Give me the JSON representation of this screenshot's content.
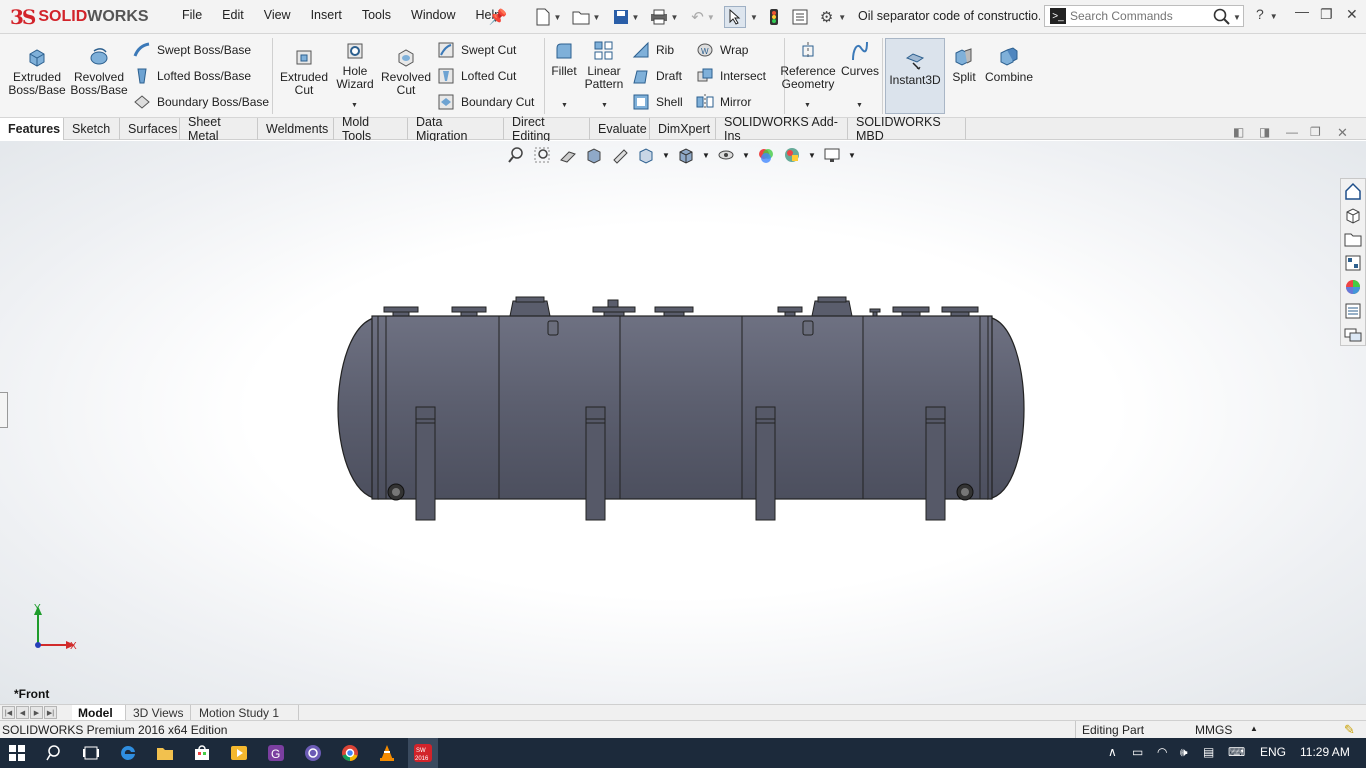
{
  "app": {
    "logo_ds": "3S",
    "logo_solid": "SOLID",
    "logo_works": "WORKS",
    "document_title": "Oil separator code of constructio...",
    "search_placeholder": "Search Commands"
  },
  "menu": [
    "File",
    "Edit",
    "View",
    "Insert",
    "Tools",
    "Window",
    "Help"
  ],
  "ribbon": {
    "extruded_boss": "Extruded\nBoss/Base",
    "revolved_boss": "Revolved\nBoss/Base",
    "swept_boss": "Swept Boss/Base",
    "lofted_boss": "Lofted Boss/Base",
    "boundary_boss": "Boundary Boss/Base",
    "extruded_cut": "Extruded\nCut",
    "hole_wizard": "Hole\nWizard",
    "revolved_cut": "Revolved\nCut",
    "swept_cut": "Swept Cut",
    "lofted_cut": "Lofted Cut",
    "boundary_cut": "Boundary Cut",
    "fillet": "Fillet",
    "linear_pattern": "Linear\nPattern",
    "rib": "Rib",
    "draft": "Draft",
    "shell": "Shell",
    "wrap": "Wrap",
    "intersect": "Intersect",
    "mirror": "Mirror",
    "reference_geometry": "Reference\nGeometry",
    "curves": "Curves",
    "instant3d": "Instant3D",
    "split": "Split",
    "combine": "Combine"
  },
  "tabs": [
    "Features",
    "Sketch",
    "Surfaces",
    "Sheet Metal",
    "Weldments",
    "Mold Tools",
    "Data Migration",
    "Direct Editing",
    "Evaluate",
    "DimXpert",
    "SOLIDWORKS Add-Ins",
    "SOLIDWORKS MBD"
  ],
  "viewport": {
    "view_name": "*Front",
    "axis_y": "Y",
    "axis_x": "X"
  },
  "model_tabs": [
    "Model",
    "3D Views",
    "Motion Study 1"
  ],
  "status": {
    "product": "SOLIDWORKS Premium 2016 x64 Edition",
    "mode": "Editing Part",
    "units": "MMGS"
  },
  "taskbar": {
    "language": "ENG",
    "time": "11:29 AM",
    "sw_badge": "2016"
  },
  "colors": {
    "brand_red": "#d2232a",
    "vessel_body": "#5b5e6e",
    "taskbar_bg": "#1c2a3b"
  }
}
